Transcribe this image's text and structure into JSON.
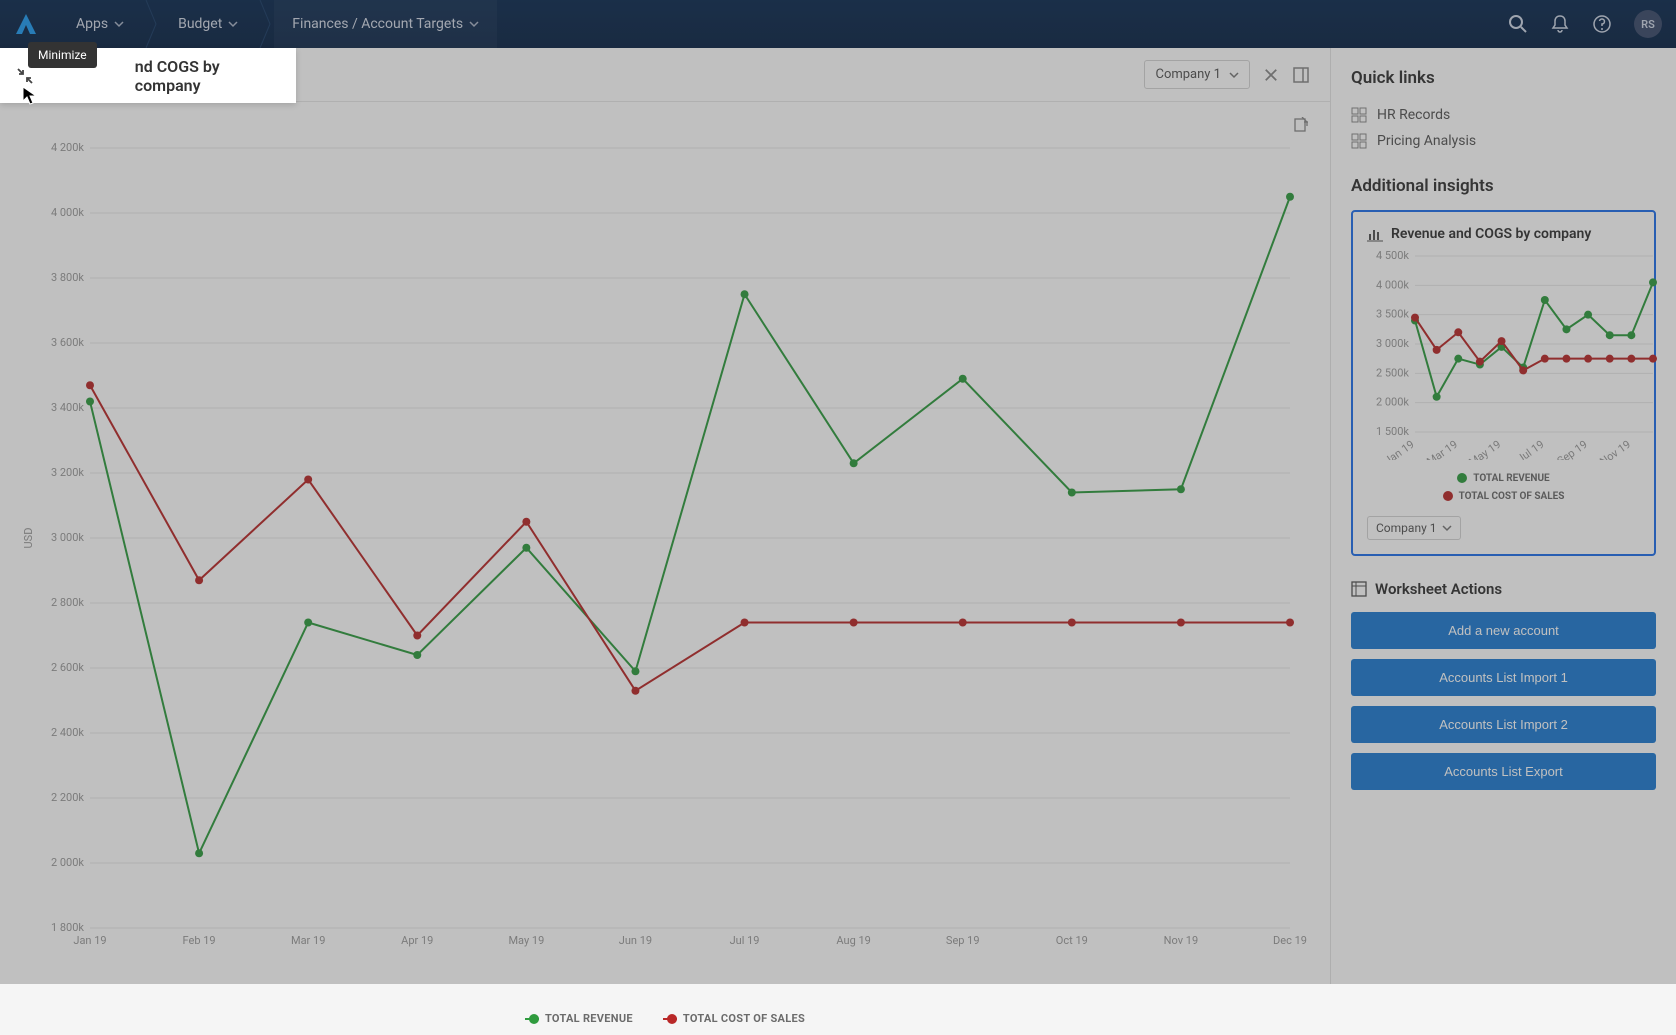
{
  "nav": {
    "apps": "Apps",
    "budget": "Budget",
    "breadcrumb": "Finances / Account Targets",
    "avatar_initials": "RS"
  },
  "chart": {
    "tooltip_minimize": "Minimize",
    "title": "Revenue and COGS by company",
    "company_selector": "Company 1",
    "y_axis_label": "USD",
    "legend_revenue": "TOTAL REVENUE",
    "legend_cogs": "TOTAL COST OF SALES"
  },
  "side": {
    "quick_links_heading": "Quick links",
    "quick_links": [
      {
        "label": "HR Records"
      },
      {
        "label": "Pricing Analysis"
      }
    ],
    "additional_insights_heading": "Additional insights",
    "insight_title": "Revenue and COGS by company",
    "mini_company_selector": "Company 1",
    "worksheet_heading": "Worksheet Actions",
    "actions": [
      "Add a new account",
      "Accounts List Import 1",
      "Accounts List Import 2",
      "Accounts List Export"
    ]
  },
  "chart_data": {
    "type": "line",
    "title": "Revenue and COGS by company",
    "xlabel": "",
    "ylabel": "USD",
    "ylim": [
      1800000,
      4200000
    ],
    "categories": [
      "Jan 19",
      "Feb 19",
      "Mar 19",
      "Apr 19",
      "May 19",
      "Jun 19",
      "Jul 19",
      "Aug 19",
      "Sep 19",
      "Oct 19",
      "Nov 19",
      "Dec 19"
    ],
    "y_ticks": [
      "1 800k",
      "2 000k",
      "2 200k",
      "2 400k",
      "2 600k",
      "2 800k",
      "3 000k",
      "3 200k",
      "3 400k",
      "3 600k",
      "3 800k",
      "4 000k",
      "4 200k"
    ],
    "series": [
      {
        "name": "TOTAL REVENUE",
        "color": "#2f9b3e",
        "values": [
          3420000,
          2030000,
          2740000,
          2640000,
          2970000,
          2590000,
          3750000,
          3230000,
          3490000,
          3140000,
          3150000,
          4050000
        ]
      },
      {
        "name": "TOTAL COST OF SALES",
        "color": "#b92828",
        "values": [
          3470000,
          2870000,
          3180000,
          2700000,
          3050000,
          2530000,
          2740000,
          2740000,
          2740000,
          2740000,
          2740000,
          2740000
        ]
      }
    ]
  },
  "mini_chart_data": {
    "type": "line",
    "ylim": [
      1500000,
      4500000
    ],
    "categories": [
      "Jan 19",
      "Mar 19",
      "May 19",
      "Jul 19",
      "Sep 19",
      "Nov 19"
    ],
    "y_ticks": [
      "1 500k",
      "2 000k",
      "2 500k",
      "3 000k",
      "3 500k",
      "4 000k",
      "4 500k"
    ],
    "series": [
      {
        "name": "TOTAL REVENUE",
        "color": "#2f9b3e",
        "values": [
          3400000,
          2100000,
          2750000,
          2650000,
          2950000,
          2600000,
          3750000,
          3250000,
          3500000,
          3150000,
          3150000,
          4050000
        ]
      },
      {
        "name": "TOTAL COST OF SALES",
        "color": "#b92828",
        "values": [
          3450000,
          2900000,
          3200000,
          2700000,
          3050000,
          2550000,
          2750000,
          2750000,
          2750000,
          2750000,
          2750000,
          2750000
        ]
      }
    ]
  }
}
